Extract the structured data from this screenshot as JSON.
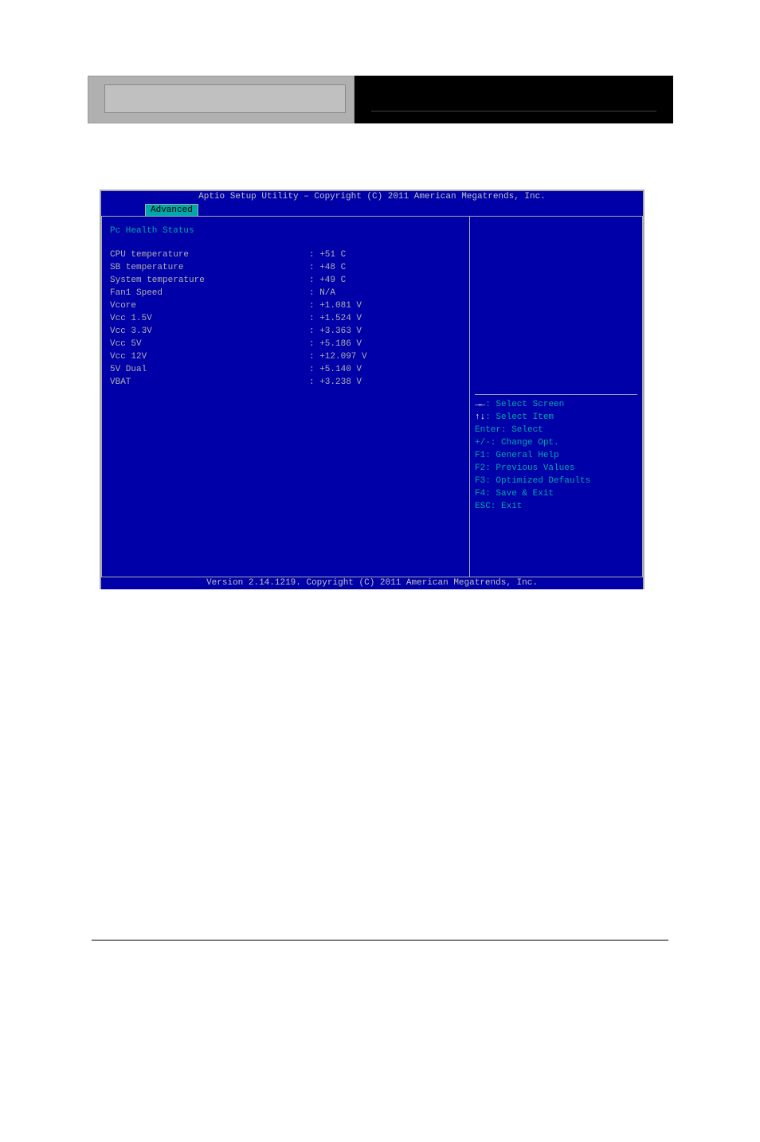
{
  "header": {
    "title_top": "Aptio Setup Utility – Copyright (C) 2011 American Megatrends, Inc.",
    "tab": "Advanced",
    "version": "Version 2.14.1219. Copyright (C) 2011 American Megatrends, Inc."
  },
  "main": {
    "section_title": "Pc Health Status",
    "rows": [
      {
        "label": "CPU temperature",
        "value": ": +51 C"
      },
      {
        "label": "SB temperature",
        "value": ": +48 C"
      },
      {
        "label": "System temperature",
        "value": ": +49 C"
      },
      {
        "label": "Fan1 Speed",
        "value": ": N/A"
      },
      {
        "label": "Vcore",
        "value": ": +1.081 V"
      },
      {
        "label": "Vcc 1.5V",
        "value": ": +1.524 V"
      },
      {
        "label": "Vcc 3.3V",
        "value": ": +3.363 V"
      },
      {
        "label": "Vcc 5V",
        "value": ": +5.186 V"
      },
      {
        "label": "Vcc 12V",
        "value": ": +12.097 V"
      },
      {
        "label": "5V Dual",
        "value": ": +5.140 V"
      },
      {
        "label": "VBAT",
        "value": ": +3.238 V"
      }
    ]
  },
  "help": {
    "lines": [
      {
        "prefix": "→←",
        "text": ": Select Screen"
      },
      {
        "prefix": "↑↓",
        "text": ": Select Item"
      },
      {
        "prefix": "",
        "text": "Enter: Select"
      },
      {
        "prefix": "",
        "text": "+/-: Change Opt."
      },
      {
        "prefix": "",
        "text": "F1: General Help"
      },
      {
        "prefix": "",
        "text": "F2: Previous Values"
      },
      {
        "prefix": "",
        "text": "F3: Optimized Defaults"
      },
      {
        "prefix": "",
        "text": "F4: Save & Exit"
      },
      {
        "prefix": "",
        "text": "ESC: Exit"
      }
    ]
  }
}
